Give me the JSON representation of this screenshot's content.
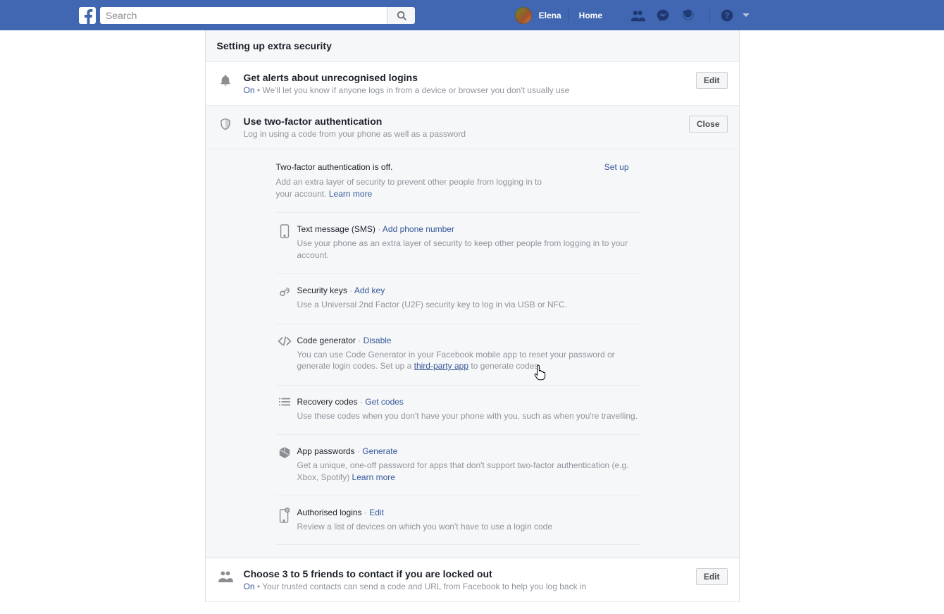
{
  "topbar": {
    "search_placeholder": "Search",
    "user_name": "Elena",
    "home_label": "Home"
  },
  "header": {
    "section_title": "Setting up extra security"
  },
  "alerts": {
    "title": "Get alerts about unrecognised logins",
    "status": "On",
    "desc": "We'll let you know if anyone logs in from a device or browser you don't usually use",
    "edit_label": "Edit"
  },
  "tfa": {
    "title": "Use two-factor authentication",
    "sub": "Log in using a code from your phone as well as a password",
    "close_label": "Close",
    "status_line": "Two-factor authentication is off.",
    "setup_label": "Set up",
    "desc_prefix": "Add an extra layer of security to prevent other people from logging in to your account. ",
    "learn_more": "Learn more",
    "methods": {
      "sms": {
        "title": "Text message (SMS)",
        "action": "Add phone number",
        "desc": "Use your phone as an extra layer of security to keep other people from logging in to your account."
      },
      "keys": {
        "title": "Security keys",
        "action": "Add key",
        "desc": "Use a Universal 2nd Factor (U2F) security key to log in via USB or NFC."
      },
      "codegen": {
        "title": "Code generator",
        "action": "Disable",
        "desc1": "You can use Code Generator in your Facebook mobile app to reset your password or generate login codes. Set up a ",
        "desc_link": "third-party app",
        "desc2": " to generate codes."
      },
      "recovery": {
        "title": "Recovery codes",
        "action": "Get codes",
        "desc": "Use these codes when you don't have your phone with you, such as when you're travelling."
      },
      "apppw": {
        "title": "App passwords",
        "action": "Generate",
        "desc_prefix": "Get a unique, one-off password for apps that don't support two-factor authentication (e.g. Xbox, Spotify) ",
        "learn_more": "Learn more"
      },
      "auth": {
        "title": "Authorised logins",
        "action": "Edit",
        "desc": "Review a list of devices on which you won't have to use a login code"
      }
    }
  },
  "trusted": {
    "title": "Choose 3 to 5 friends to contact if you are locked out",
    "status": "On",
    "desc": "Your trusted contacts can send a code and URL from Facebook to help you log back in",
    "edit_label": "Edit"
  }
}
